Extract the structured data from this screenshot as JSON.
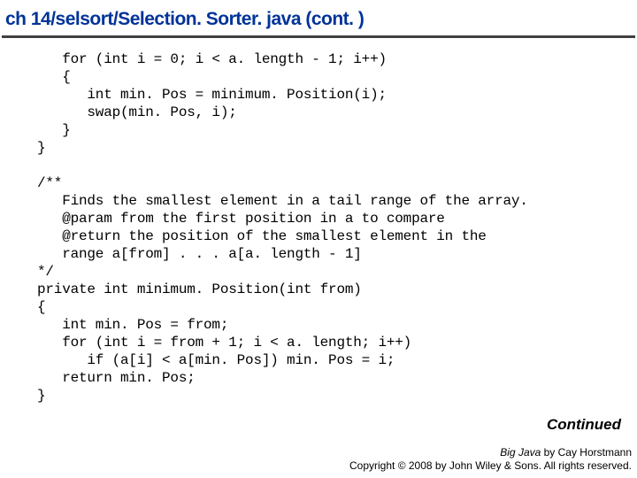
{
  "title": "ch 14/selsort/Selection. Sorter. java   (cont. )",
  "code": "   for (int i = 0; i < a. length - 1; i++)\n   {\n      int min. Pos = minimum. Position(i);\n      swap(min. Pos, i);\n   }\n}\n\n/**\n   Finds the smallest element in a tail range of the array.\n   @param from the first position in a to compare\n   @return the position of the smallest element in the\n   range a[from] . . . a[a. length - 1]\n*/\nprivate int minimum. Position(int from)\n{\n   int min. Pos = from;\n   for (int i = from + 1; i < a. length; i++)\n      if (a[i] < a[min. Pos]) min. Pos = i;\n   return min. Pos;\n}",
  "continued": "Continued",
  "footer": {
    "line1_italic": "Big Java ",
    "line1_rest": "by Cay Horstmann",
    "line2": "Copyright © 2008 by John Wiley & Sons. All rights reserved."
  }
}
